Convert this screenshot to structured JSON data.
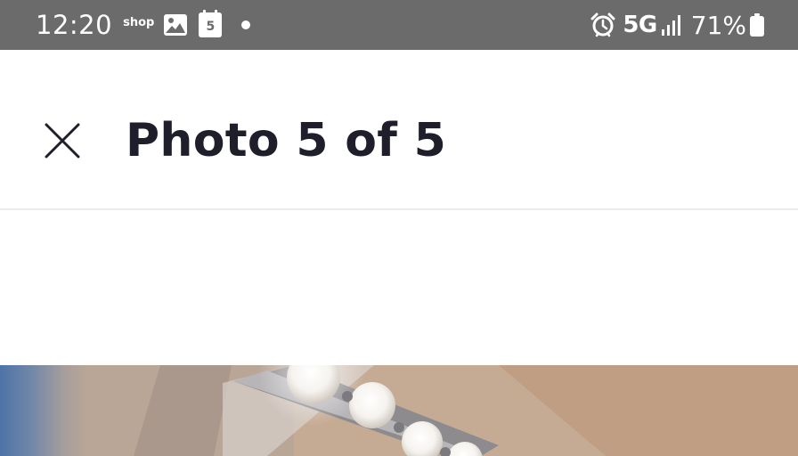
{
  "status_bar": {
    "time": "12:20",
    "shop_label": "shop",
    "calendar_day": "5",
    "network": "5G",
    "battery": "71%",
    "icons": [
      "gallery-icon",
      "calendar-icon",
      "dot-icon",
      "alarm-icon",
      "signal-icon",
      "battery-icon"
    ],
    "background_color": "#6b6b6b"
  },
  "header": {
    "title": "Photo 5 of 5",
    "close_icon": "close-icon"
  },
  "photo": {
    "subject": "bathroom-vanity-light-fixture",
    "visible": true
  }
}
